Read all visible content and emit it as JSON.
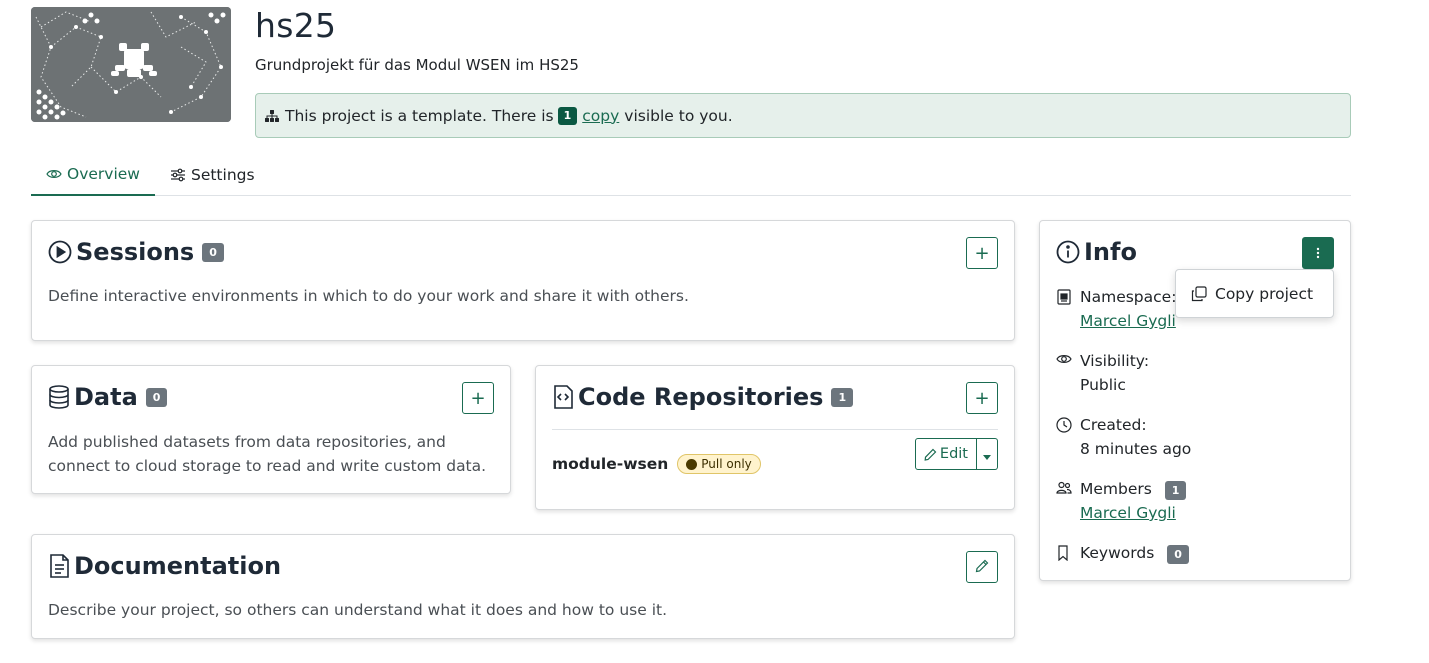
{
  "project": {
    "title": "hs25",
    "description": "Grundprojekt für das Modul WSEN im HS25",
    "banner_image": "network-frog-pattern"
  },
  "template_alert": {
    "icon": "sitemap-icon",
    "text_before": "This project is a template. There is",
    "count": "1",
    "link_text": "copy",
    "text_after": "visible to you."
  },
  "tabs": [
    {
      "label": "Overview",
      "icon": "eye-icon",
      "active": true
    },
    {
      "label": "Settings",
      "icon": "sliders-icon",
      "active": false
    }
  ],
  "sessions": {
    "title": "Sessions",
    "count": "0",
    "description": "Define interactive environments in which to do your work and share it with others.",
    "add_label": "+"
  },
  "data": {
    "title": "Data",
    "count": "0",
    "description": "Add published datasets from data repositories, and connect to cloud storage to read and write custom data.",
    "add_label": "+"
  },
  "code_repositories": {
    "title": "Code Repositories",
    "count": "1",
    "add_label": "+",
    "repos": [
      {
        "name": "module-wsen",
        "badge": "Pull only",
        "edit_label": "Edit"
      }
    ]
  },
  "documentation": {
    "title": "Documentation",
    "description": "Describe your project, so others can understand what it does and how to use it."
  },
  "info": {
    "title": "Info",
    "namespace_label": "Namespace:",
    "namespace_value": "Marcel Gygli",
    "visibility_label": "Visibility:",
    "visibility_value": "Public",
    "created_label": "Created:",
    "created_value": "8 minutes ago",
    "members_label": "Members",
    "members_count": "1",
    "members_value": "Marcel Gygli",
    "keywords_label": "Keywords",
    "keywords_count": "0"
  },
  "dropdown": {
    "copy_project_label": "Copy project"
  },
  "colors": {
    "primary": "#1a6b51",
    "alert_bg": "#e6f0eb",
    "badge_gray": "#6c757d",
    "pull_badge_bg": "#fff3cd"
  }
}
